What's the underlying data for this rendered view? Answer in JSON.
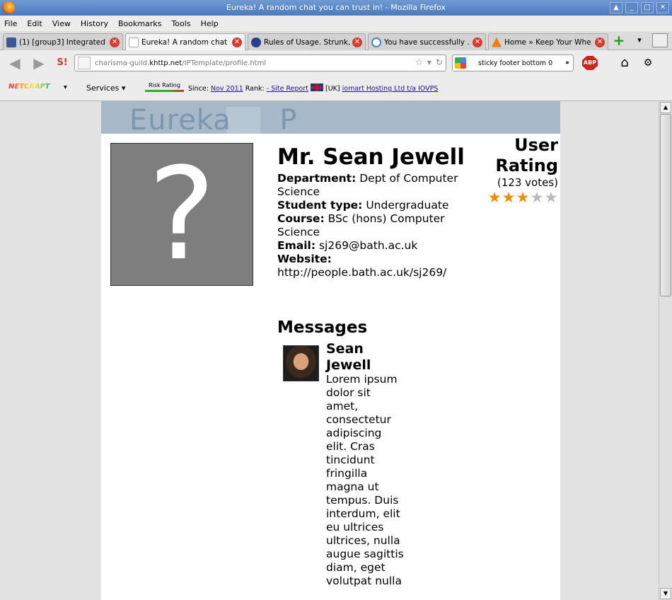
{
  "window": {
    "title": "Eureka! A random chat you can trust in! - Mozilla Firefox",
    "controls": [
      "▲",
      "_",
      "□",
      "✕"
    ]
  },
  "menu": [
    "File",
    "Edit",
    "View",
    "History",
    "Bookmarks",
    "Tools",
    "Help"
  ],
  "tabs": [
    {
      "label": "(1) [group3] Integrated ...",
      "icon": "facebook-icon",
      "active": false
    },
    {
      "label": "Eureka! A random chat ...",
      "icon": "page-icon",
      "active": true
    },
    {
      "label": "Rules of Usage. Strunk, ...",
      "icon": "globe-icon",
      "active": false
    },
    {
      "label": "You have successfully ...",
      "icon": "info-icon",
      "active": false
    },
    {
      "label": "Home » Keep Your Whe...",
      "icon": "vlc-icon",
      "active": false
    }
  ],
  "nav": {
    "url_prefix": "charisma-guild.",
    "url_host": "khttp.net",
    "url_path": "/IPTemplate/profile.html",
    "search_value": "sticky footer bottom 0"
  },
  "netcraft": {
    "logo": "NETCRAFT",
    "services": "Services",
    "risk": "Risk Rating",
    "since_label": "Since:",
    "since_value": "Nov 2011",
    "rank_label": "Rank:",
    "rank_value": "- Site Report",
    "country": "[UK]",
    "host": "iomart Hosting Ltd t/a IOVPS"
  },
  "site": {
    "logo": "Eureka     P"
  },
  "profile": {
    "name": "Mr. Sean Jewell",
    "department_label": "Department:",
    "department": "Dept of Computer Science",
    "student_type_label": "Student type:",
    "student_type": "Undergraduate",
    "course_label": "Course:",
    "course": "BSc (hons) Computer Science",
    "email_label": "Email:",
    "email": "sj269@bath.ac.uk",
    "website_label": "Website:",
    "website": "http://people.bath.ac.uk/sj269/"
  },
  "rating": {
    "title": "User Rating",
    "votes": "(123 votes)",
    "stars_filled": 3,
    "stars_total": 5
  },
  "messages": {
    "title": "Messages",
    "items": [
      {
        "author": "Sean Jewell",
        "text": "Lorem ipsum dolor sit amet, consectetur adipiscing elit. Cras tincidunt fringilla magna ut tempus. Duis interdum, elit eu ultrices ultrices, nulla augue sagittis diam, eget volutpat nulla"
      }
    ]
  },
  "colors": {
    "header": "#a7b9c9",
    "star_on": "#f08c00",
    "star_off": "#b9b9b9"
  }
}
